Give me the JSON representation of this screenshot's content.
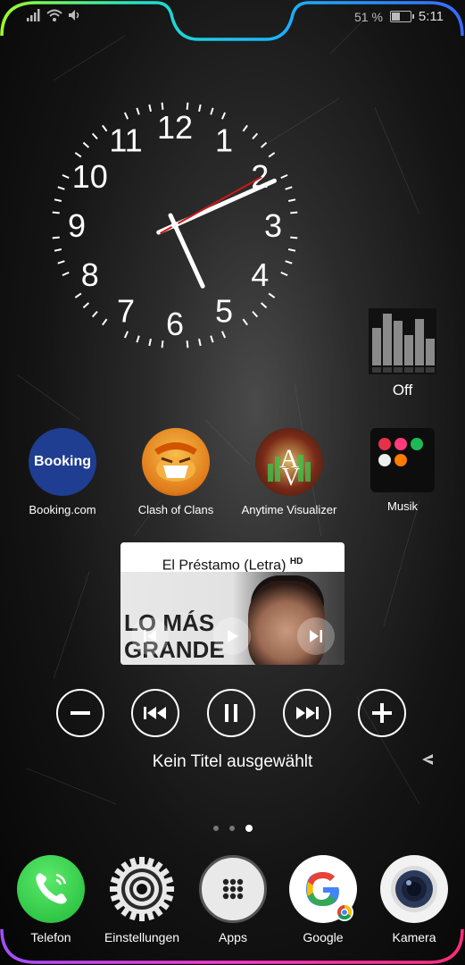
{
  "status_bar": {
    "battery_text": "51 %",
    "battery_level": 0.51,
    "time": "5:11"
  },
  "widgets": {
    "clock": {
      "numerals": [
        "12",
        "1",
        "2",
        "3",
        "4",
        "5",
        "6",
        "7",
        "8",
        "9",
        "10",
        "11"
      ]
    },
    "visualizer": {
      "label": "Off"
    }
  },
  "apps": [
    {
      "label": "Booking.com",
      "icon": "booking-icon",
      "icon_text": "Booking"
    },
    {
      "label": "Clash of Clans",
      "icon": "clash-of-clans-icon"
    },
    {
      "label": "Anytime Visualizer",
      "icon": "anytime-visualizer-icon"
    },
    {
      "label": "Musik",
      "icon": "music-folder-icon"
    }
  ],
  "music_widget": {
    "title": "El Préstamo (Letra)",
    "badge": "HD",
    "thumbnail_text": [
      "LO MÁS",
      "GRANDE"
    ]
  },
  "media": {
    "status": "Kein Titel ausgewählt"
  },
  "page_indicator": {
    "count": 3,
    "active": 3
  },
  "dock": [
    {
      "label": "Telefon",
      "icon": "phone-icon"
    },
    {
      "label": "Einstellungen",
      "icon": "settings-icon"
    },
    {
      "label": "Apps",
      "icon": "apps-grid-icon"
    },
    {
      "label": "Google",
      "icon": "google-icon"
    },
    {
      "label": "Kamera",
      "icon": "camera-icon"
    }
  ],
  "colors": {
    "booking": "#1f3d91",
    "phone_green": "#2fc94a",
    "google_red": "#ea4335",
    "google_blue": "#4285f4",
    "google_yellow": "#fbbc05",
    "google_green": "#34a853"
  }
}
